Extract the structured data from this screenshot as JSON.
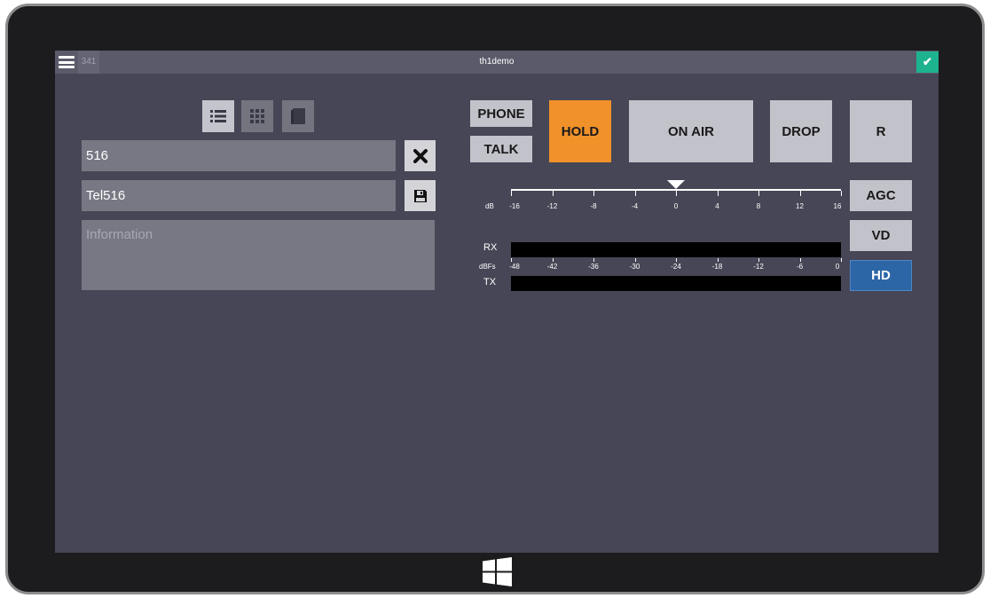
{
  "titlebar": {
    "line_number": "341",
    "title": "th1demo"
  },
  "left_panel": {
    "number_value": "516",
    "name_value": "Tel516",
    "info_placeholder": "Information"
  },
  "buttons": {
    "phone": "PHONE",
    "talk": "TALK",
    "hold": "HOLD",
    "on_air": "ON AIR",
    "drop": "DROP",
    "r": "R",
    "agc": "AGC",
    "vd": "VD",
    "hd": "HD"
  },
  "gain_scale": {
    "unit": "dB",
    "ticks": [
      "-16",
      "-12",
      "-8",
      "-4",
      "0",
      "4",
      "8",
      "12",
      "16"
    ],
    "current_db": 0
  },
  "level_meter": {
    "rx_label": "RX",
    "tx_label": "TX",
    "unit": "dBFs",
    "ticks": [
      "-48",
      "-42",
      "-36",
      "-30",
      "-24",
      "-18",
      "-12",
      "-6",
      "0"
    ],
    "rx_level": 0,
    "tx_level": 0
  },
  "colors": {
    "hold_active": "#f0912a",
    "hd_active": "#2d66a6",
    "status_ok": "#1eb38f",
    "screen_bg": "#464656"
  },
  "icons": {
    "menu": "hamburger-icon",
    "status": "check-icon",
    "view_list": "list-icon",
    "view_grid": "grid-icon",
    "view_book": "book-icon",
    "clear": "close-icon",
    "save": "floppy-disk-icon",
    "start": "windows-logo-icon"
  }
}
